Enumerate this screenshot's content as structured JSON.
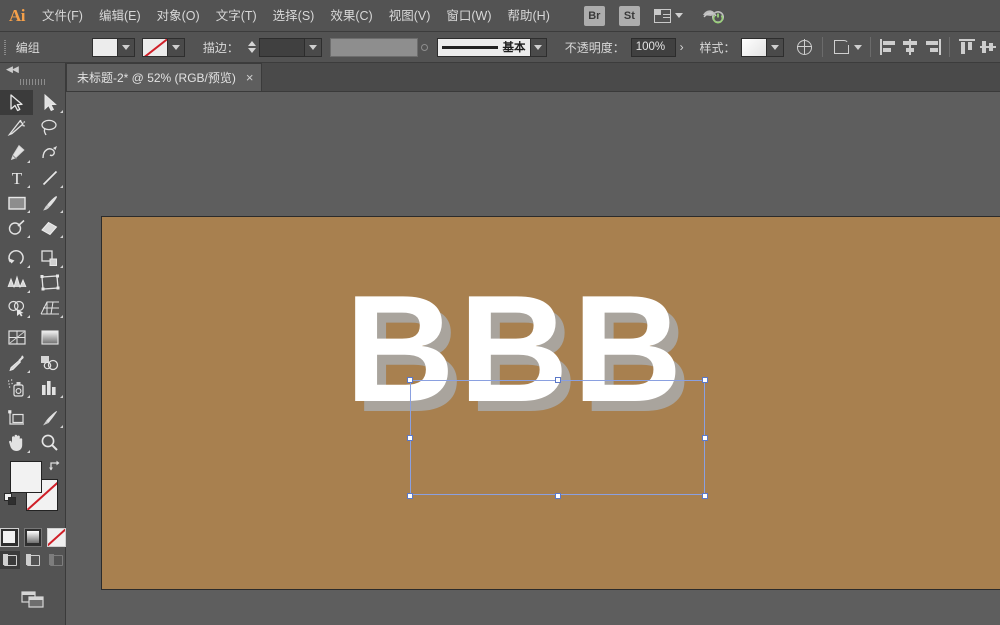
{
  "app": {
    "name": "Adobe Illustrator",
    "logo_text": "Ai"
  },
  "menubar": {
    "items": [
      {
        "label": "文件(F)",
        "name": "menu-file"
      },
      {
        "label": "编辑(E)",
        "name": "menu-edit"
      },
      {
        "label": "对象(O)",
        "name": "menu-object"
      },
      {
        "label": "文字(T)",
        "name": "menu-type"
      },
      {
        "label": "选择(S)",
        "name": "menu-select"
      },
      {
        "label": "效果(C)",
        "name": "menu-effect"
      },
      {
        "label": "视图(V)",
        "name": "menu-view"
      },
      {
        "label": "窗口(W)",
        "name": "menu-window"
      },
      {
        "label": "帮助(H)",
        "name": "menu-help"
      }
    ],
    "bridge_badge": "Br",
    "stock_badge": "St",
    "arrange_icon": "arrange-documents-icon",
    "cc_icon": "creative-cloud-icon"
  },
  "controlbar": {
    "selection_label": "编组",
    "fill_swatch_color": "#ececec",
    "stroke_swatch": "none",
    "stroke_label": "描边：",
    "stroke_weight_value": "",
    "opacity_field_value": "",
    "brush_name": "基本",
    "opacity_label": "不透明度：",
    "opacity_value": "100%",
    "style_label": "样式：",
    "style_swatch_color": "#f0f0f0",
    "recolor_icon": "recolor-artwork-icon",
    "transform_icon": "transform-icon",
    "align_icons": [
      "align-left-icon",
      "align-horizontal-center-icon",
      "align-right-icon",
      "align-top-icon",
      "align-vertical-center-icon"
    ]
  },
  "tab": {
    "title": "未标题-2* @ 52% (RGB/预览)",
    "close_label": "×"
  },
  "toolbox": {
    "collapse_label": "◀◀",
    "tools": [
      {
        "name": "selection-tool",
        "label": "选择工具",
        "active": true,
        "corner": false
      },
      {
        "name": "direct-selection-tool",
        "label": "直接选择工具",
        "active": false,
        "corner": true
      },
      {
        "name": "magic-wand-tool",
        "label": "魔棒工具",
        "active": false,
        "corner": false
      },
      {
        "name": "lasso-tool",
        "label": "套索工具",
        "active": false,
        "corner": false
      },
      {
        "name": "pen-tool",
        "label": "钢笔工具",
        "active": false,
        "corner": true
      },
      {
        "name": "curvature-tool",
        "label": "曲率工具",
        "active": false,
        "corner": false
      },
      {
        "name": "type-tool",
        "label": "文字工具",
        "active": false,
        "corner": true
      },
      {
        "name": "line-segment-tool",
        "label": "直线段工具",
        "active": false,
        "corner": true
      },
      {
        "name": "rectangle-tool",
        "label": "矩形工具",
        "active": false,
        "corner": true
      },
      {
        "name": "paintbrush-tool",
        "label": "画笔工具",
        "active": false,
        "corner": true
      },
      {
        "name": "shaper-tool",
        "label": "Shaper 工具",
        "active": false,
        "corner": true
      },
      {
        "name": "eraser-tool",
        "label": "橡皮擦工具",
        "active": false,
        "corner": true
      },
      {
        "name": "rotate-tool",
        "label": "旋转工具",
        "active": false,
        "corner": true
      },
      {
        "name": "scale-tool",
        "label": "比例缩放工具",
        "active": false,
        "corner": true
      },
      {
        "name": "width-tool",
        "label": "宽度工具",
        "active": false,
        "corner": true
      },
      {
        "name": "free-transform-tool",
        "label": "自由变换工具",
        "active": false,
        "corner": false
      },
      {
        "name": "shape-builder-tool",
        "label": "形状生成器工具",
        "active": false,
        "corner": true
      },
      {
        "name": "perspective-grid-tool",
        "label": "透视网格工具",
        "active": false,
        "corner": true
      },
      {
        "name": "mesh-tool",
        "label": "网格工具",
        "active": false,
        "corner": false
      },
      {
        "name": "gradient-tool",
        "label": "渐变工具",
        "active": false,
        "corner": false
      },
      {
        "name": "eyedropper-tool",
        "label": "吸管工具",
        "active": false,
        "corner": true
      },
      {
        "name": "blend-tool",
        "label": "混合工具",
        "active": false,
        "corner": false
      },
      {
        "name": "symbol-sprayer-tool",
        "label": "符号喷枪工具",
        "active": false,
        "corner": true
      },
      {
        "name": "column-graph-tool",
        "label": "柱形图工具",
        "active": false,
        "corner": true
      },
      {
        "name": "artboard-tool",
        "label": "画板工具",
        "active": false,
        "corner": false
      },
      {
        "name": "slice-tool",
        "label": "切片工具",
        "active": false,
        "corner": true
      },
      {
        "name": "hand-tool",
        "label": "抓手工具",
        "active": false,
        "corner": true
      },
      {
        "name": "zoom-tool",
        "label": "缩放工具",
        "active": false,
        "corner": false
      }
    ],
    "fill_color": "#f2f2f2",
    "stroke_color": "none",
    "swap_icon": "swap-fill-stroke-icon",
    "default_icon": "default-fill-stroke-icon",
    "color_modes": [
      {
        "name": "color-mode-button",
        "label": "颜色"
      },
      {
        "name": "gradient-mode-button",
        "label": "渐变"
      },
      {
        "name": "none-mode-button",
        "label": "无"
      }
    ],
    "screen_modes": [
      {
        "name": "drawing-mode-normal-button",
        "label": "正常绘图",
        "active": true
      },
      {
        "name": "drawing-mode-behind-button",
        "label": "背面绘图",
        "active": false
      },
      {
        "name": "drawing-mode-inside-button",
        "label": "内部绘图",
        "active": false
      }
    ],
    "screen_mode_button": "change-screen-mode-button"
  },
  "canvas": {
    "artboard_color": "#a8804f",
    "artwork_text": "BBB",
    "artwork_fill": "#ffffff",
    "artwork_shadow": "#a8a8a8",
    "zoom_level": "52%",
    "selection": {
      "handles": 8,
      "handle_color": "#ffffff",
      "border_color": "#8aa0e0"
    }
  }
}
